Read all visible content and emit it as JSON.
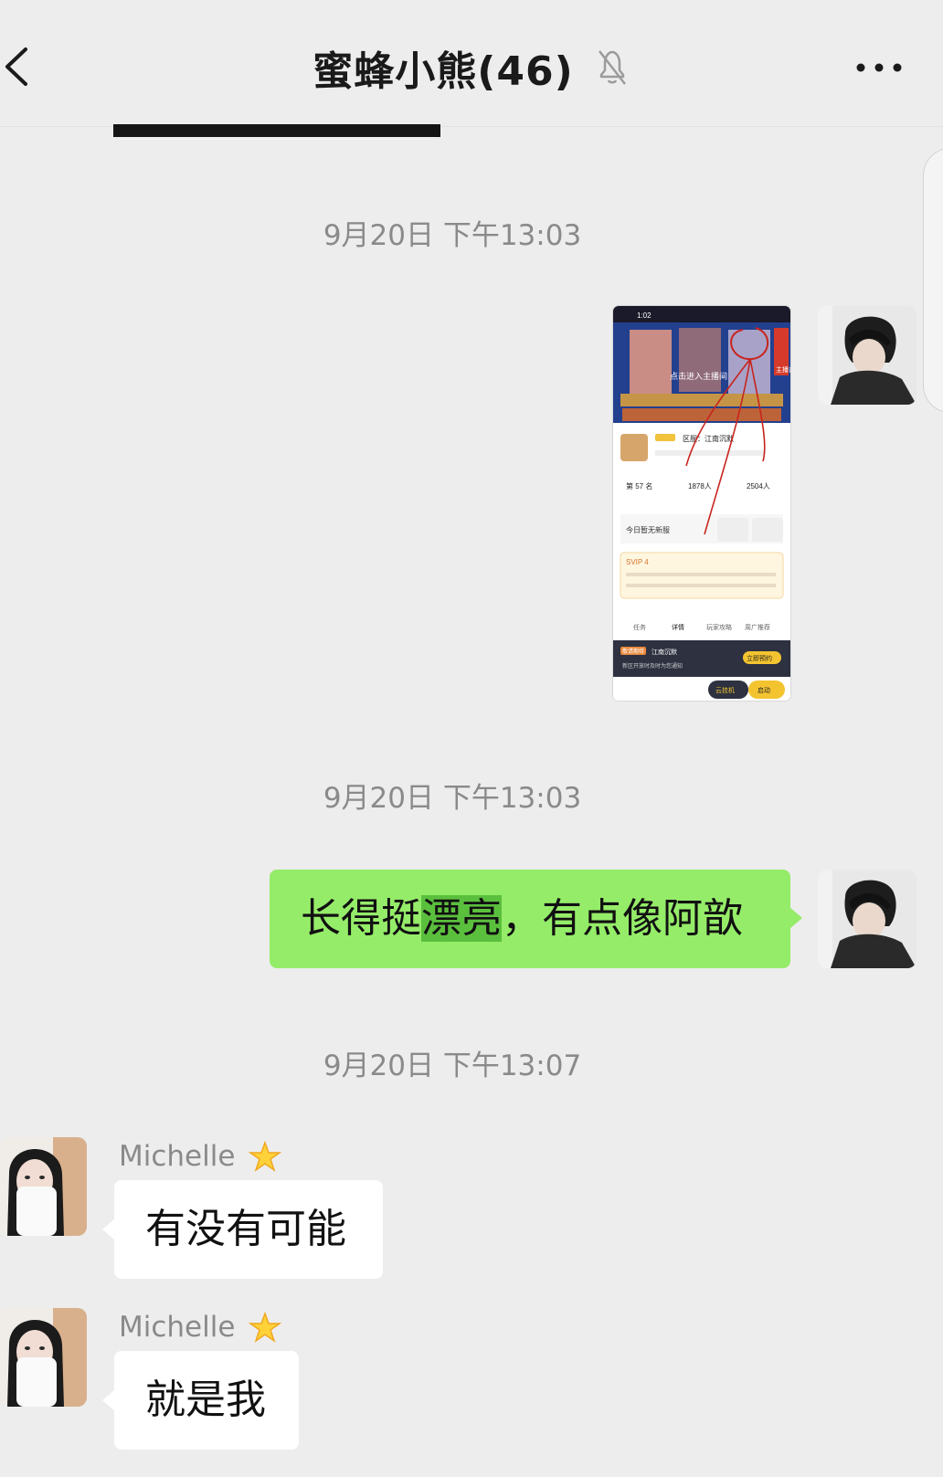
{
  "header": {
    "title": "蜜蜂小熊(46)",
    "back_icon": "chevron-left-icon",
    "mute_icon": "bell-off-icon",
    "more_icon": "more-dots-icon"
  },
  "messages": [
    {
      "timestamp": "9月20日 下午13:03",
      "type": "image",
      "from": "me"
    },
    {
      "timestamp": "9月20日 下午13:03",
      "type": "text",
      "from": "me",
      "text_before": "长得挺",
      "text_highlight": "漂亮",
      "text_after": "，有点像阿歆"
    },
    {
      "timestamp": "9月20日 下午13:07",
      "type": "text",
      "from": "Michelle",
      "sender": "Michelle",
      "text": "有没有可能"
    },
    {
      "type": "text",
      "from": "Michelle",
      "sender": "Michelle",
      "text": "就是我"
    }
  ],
  "colors": {
    "background": "#ededed",
    "bubble_me": "#95ec69",
    "bubble_other": "#ffffff",
    "highlight": "#5bbf3e"
  },
  "shared_screenshot": {
    "status_time": "1:02",
    "banner_text": "点击进入主播间",
    "banner_side": "主播首发",
    "server_label": "区服：江南沉默",
    "rank": "第 57 名",
    "players_a": "1878人",
    "players_b": "2504人",
    "new_server": "今日暂无新服",
    "svip": "SVIP 4",
    "tabs": [
      "任务",
      "详情",
      "玩家攻略",
      "周广推荐"
    ],
    "promo_tag": "敬请期待",
    "promo_title": "江南沉默",
    "promo_sub": "新区开放时及时为您通知",
    "promo_button": "立即预约",
    "bottom_left": "云挂机",
    "bottom_right": "启动"
  }
}
